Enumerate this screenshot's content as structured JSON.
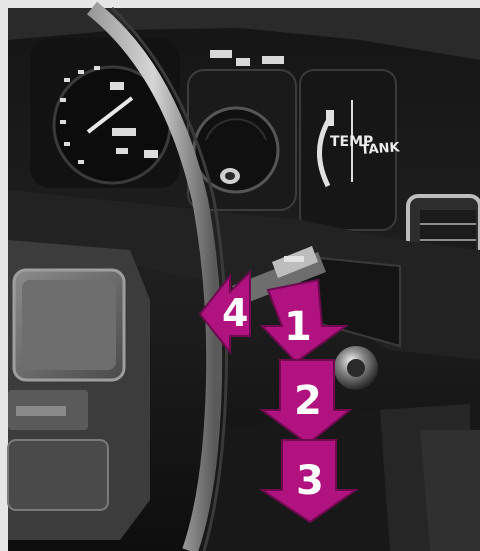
{
  "photo": {
    "subject": "car dashboard with steering-column stalk and numbered position arrows",
    "gauges": {
      "temp_label": "TEMP",
      "tank_label": "TANK"
    },
    "arrows": {
      "color": "#b0127f",
      "labels": [
        "1",
        "2",
        "3",
        "4"
      ]
    }
  }
}
